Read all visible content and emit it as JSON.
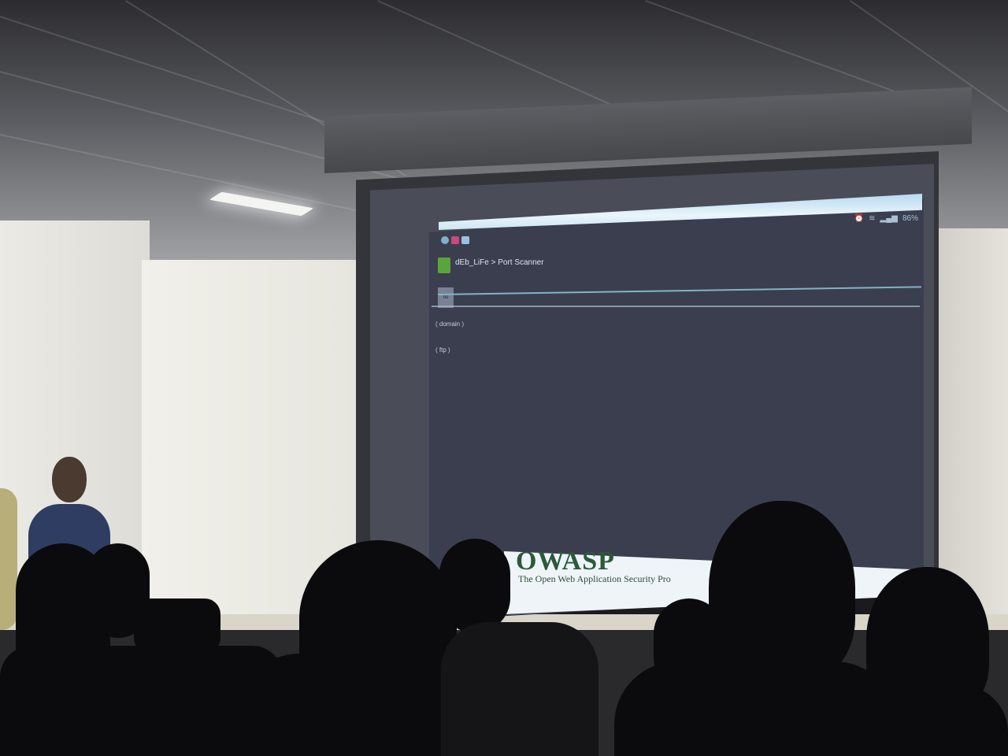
{
  "scene": {
    "colors": {
      "wall": "#e8e7e1",
      "ceiling": "#6b6c70",
      "screen": "#3b3e4e",
      "silhouette": "#0b0b0d"
    }
  },
  "projected_ui": {
    "status_bar": {
      "battery": "86%"
    },
    "header": {
      "title": "dEb_LiFe > Port Scanner"
    },
    "input": {
      "value": "no"
    },
    "hints": [
      "( domain )",
      "( ftp )"
    ]
  },
  "banner": {
    "logo": "OWASP",
    "tagline": "The Open Web Application Security Pro"
  }
}
